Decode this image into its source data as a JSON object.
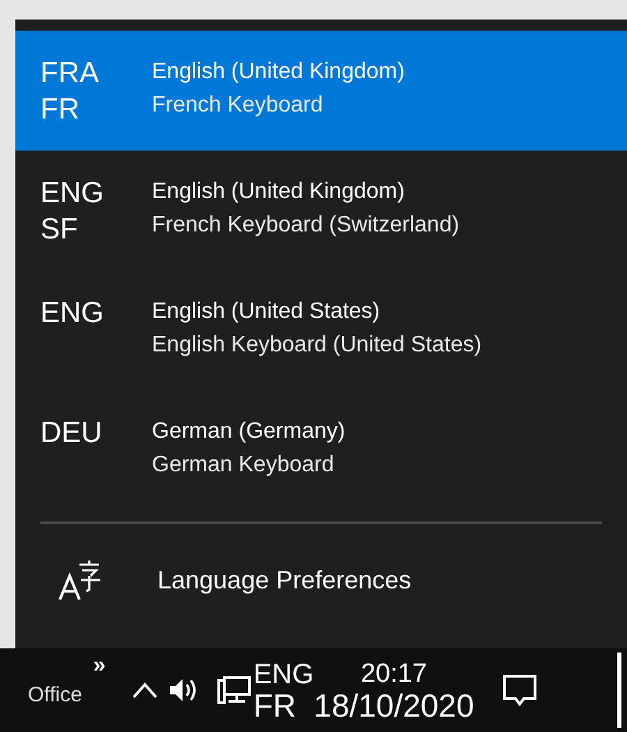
{
  "languages": [
    {
      "code": "FRA",
      "subcode": "FR",
      "language": "English (United Kingdom)",
      "keyboard": "French Keyboard",
      "selected": true
    },
    {
      "code": "ENG",
      "subcode": "SF",
      "language": "English (United Kingdom)",
      "keyboard": "French Keyboard (Switzerland)",
      "selected": false
    },
    {
      "code": "ENG",
      "language": "English (United States)",
      "keyboard": "English Keyboard (United States)",
      "selected": false
    },
    {
      "code": "DEU",
      "language": "German (Germany)",
      "keyboard": "German Keyboard",
      "selected": false
    }
  ],
  "preferences_link": "Language Preferences",
  "taskbar": {
    "toolbar": "Office",
    "overflow": "»",
    "input_code": "ENG",
    "input_subcode": "FR",
    "time": "20:17",
    "date": "18/10/2020"
  }
}
